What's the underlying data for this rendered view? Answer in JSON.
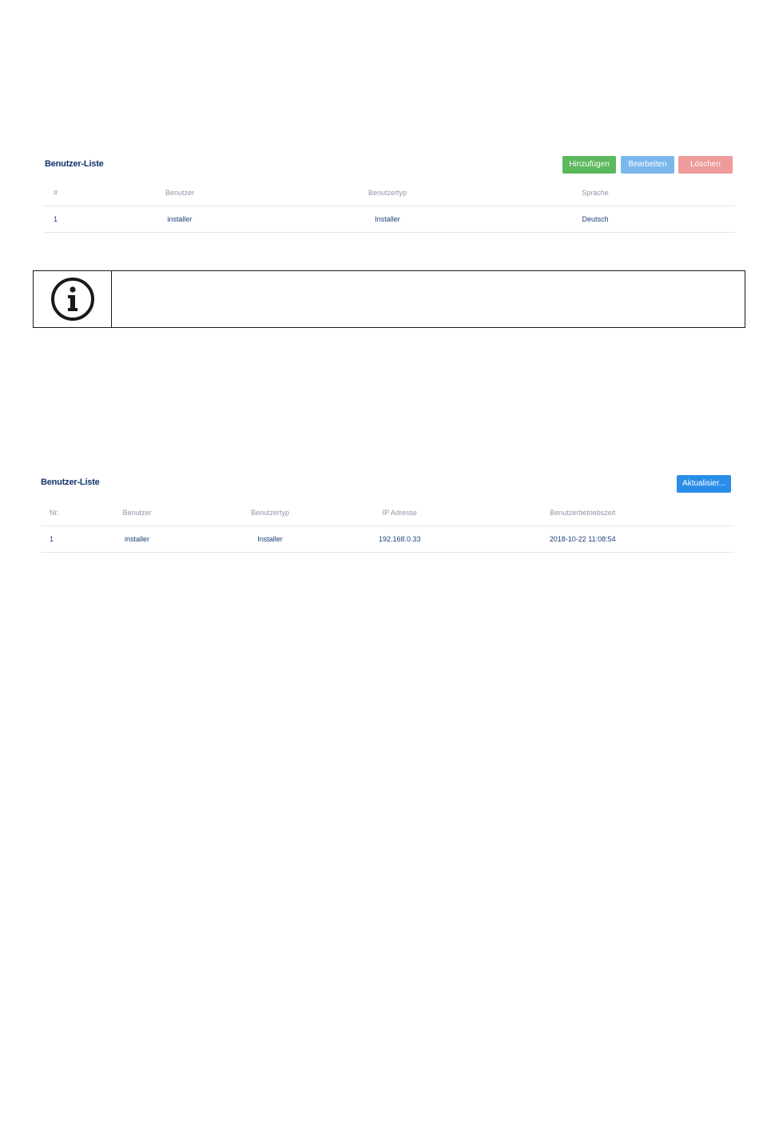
{
  "user_list": {
    "title": "Benutzer-Liste",
    "buttons": {
      "add": "Hinzufügen",
      "edit": "Bearbeiten",
      "delete": "Löschen"
    },
    "columns": [
      "#",
      "Benutzer",
      "Benutzertyp",
      "Sprache"
    ],
    "rows": [
      [
        "1",
        "installer",
        "Installer",
        "Deutsch"
      ]
    ]
  },
  "note": {
    "icon": "info-icon",
    "text": ""
  },
  "active_users": {
    "title": "Benutzer-Liste",
    "buttons": {
      "refresh": "Aktualisier..."
    },
    "columns": [
      "Nr.",
      "Benutzer",
      "Benutzertyp",
      "IP Adresse",
      "Benutzerbetriebszeit"
    ],
    "rows": [
      [
        "1",
        "installer",
        "Installer",
        "192.168.0.33",
        "2018-10-22 11:08:54"
      ]
    ]
  },
  "colors": {
    "title": "#12356b",
    "add_button": "#5cb85c",
    "edit_button": "#7ab8ec",
    "delete_button": "#ee9b9b",
    "refresh_button": "#2a8ee8",
    "header_text": "#8d96a4",
    "cell_text": "#1d3f78"
  }
}
